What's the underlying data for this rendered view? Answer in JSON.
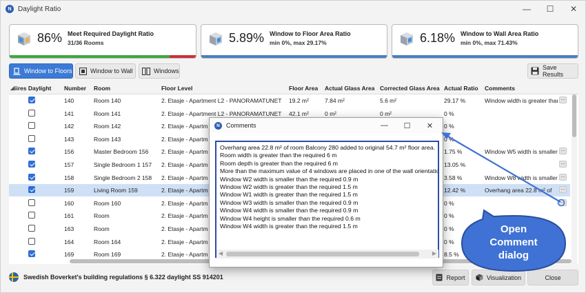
{
  "window": {
    "title": "Daylight Ratio",
    "app_icon": "N"
  },
  "colors": {
    "accent": "#3c7ad6",
    "green": "#3fa63f",
    "red": "#c8303c",
    "bar_blue": "#4a7fc1",
    "callout": "#3f72d4"
  },
  "cards": [
    {
      "pct": "86%",
      "title": "Meet Required Daylight Ratio",
      "sub": "31/36 Rooms",
      "green_fraction": 0.86
    },
    {
      "pct": "5.89%",
      "title": "Window to Floor Area Ratio",
      "sub": "min 0%, max 29.17%"
    },
    {
      "pct": "6.18%",
      "title": "Window to Wall Area Ratio",
      "sub": "min 0%, max 71.43%"
    }
  ],
  "toolbar": {
    "tab_floor": "Window to Floors",
    "tab_wall": "Window to Wall",
    "tab_windows": "Windows",
    "save": "Save Results"
  },
  "table": {
    "headers": [
      "iires Daylight",
      "Number",
      "Room",
      "Floor Level",
      "Floor Area",
      "Actual Glass Area",
      "Corrected Glass Area",
      "Actual Ratio",
      "Comments"
    ],
    "rows": [
      {
        "checked": true,
        "number": "140",
        "room": "Room 140",
        "floor": "2. Etasje - Apartment L2 - PANORAMATUNET",
        "area": "19.2 m²",
        "glass": "7.84 m²",
        "corrected": "5.6 m²",
        "ratio": "29.17 %",
        "comment": "Window  width is greater than",
        "dots": "..."
      },
      {
        "checked": false,
        "number": "141",
        "room": "Room 141",
        "floor": "2. Etasje - Apartment L2 - PANORAMATUNET",
        "area": "42.1 m²",
        "glass": "0 m²",
        "corrected": "0 m²",
        "ratio": "0 %",
        "comment": "",
        "dots": ""
      },
      {
        "checked": false,
        "number": "142",
        "room": "Room 142",
        "floor": "2. Etasje - Apartm",
        "area": "",
        "glass": "",
        "corrected": "",
        "ratio": "0 %",
        "comment": "",
        "dots": ""
      },
      {
        "checked": false,
        "number": "143",
        "room": "Room 143",
        "floor": "2. Etasje - Apartm",
        "area": "",
        "glass": "",
        "corrected": "",
        "ratio": "0 %",
        "comment": "",
        "dots": ""
      },
      {
        "checked": true,
        "number": "156",
        "room": "Master Bedroom 156",
        "floor": "2. Etasje - Apartm",
        "area": "",
        "glass": "",
        "corrected": "",
        "ratio": "1.75 %",
        "comment": "Window W5 width is smaller",
        "dots": "..."
      },
      {
        "checked": true,
        "number": "157",
        "room": "Single Bedroom 1 157",
        "floor": "2. Etasje - Apartm",
        "area": "",
        "glass": "",
        "corrected": "",
        "ratio": "13.05 %",
        "comment": "",
        "dots": "..."
      },
      {
        "checked": true,
        "number": "158",
        "room": "Single Bedroom 2 158",
        "floor": "2. Etasje - Apartm",
        "area": "",
        "glass": "",
        "corrected": "",
        "ratio": "3.58 %",
        "comment": "Window W8 width is smaller",
        "dots": "..."
      },
      {
        "checked": true,
        "number": "159",
        "room": "Living Room 159",
        "floor": "2. Etasje - Apartm",
        "area": "",
        "glass": "",
        "corrected": "",
        "ratio": "12.42 %",
        "comment": "Overhang area 22.8 m² of",
        "dots": "...",
        "selected": true
      },
      {
        "checked": false,
        "number": "160",
        "room": "Room 160",
        "floor": "2. Etasje - Apartm",
        "area": "",
        "glass": "",
        "corrected": "",
        "ratio": "0 %",
        "comment": "",
        "dots": "..."
      },
      {
        "checked": false,
        "number": "161",
        "room": "Room",
        "floor": "2. Etasje - Apartm",
        "area": "",
        "glass": "",
        "corrected": "",
        "ratio": "0 %",
        "comment": "",
        "dots": ""
      },
      {
        "checked": false,
        "number": "163",
        "room": "Room",
        "floor": "2. Etasje - Apartm",
        "area": "",
        "glass": "",
        "corrected": "",
        "ratio": "0 %",
        "comment": "",
        "dots": ""
      },
      {
        "checked": false,
        "number": "164",
        "room": "Room 164",
        "floor": "2. Etasje - Apartm",
        "area": "",
        "glass": "",
        "corrected": "",
        "ratio": "0 %",
        "comment": "",
        "dots": ""
      },
      {
        "checked": true,
        "number": "169",
        "room": "Room 169",
        "floor": "2. Etasje - Apartm",
        "area": "",
        "glass": "",
        "corrected": "",
        "ratio": "8.5 %",
        "comment": "",
        "dots": ""
      }
    ]
  },
  "footer": {
    "regulation": "Swedish Boverket's building regulations § 6.322 daylight SS 914201",
    "report": "Report",
    "visualization": "Visualization",
    "close": "Close"
  },
  "dialog": {
    "title": "Comments",
    "lines": [
      "Overhang area 22.8 m² of room Balcony 280 added to original 54.7 m² floor area.",
      "Room width is greater than the required 6 m",
      "Room depth is greater than the required 6 m",
      "More than the maximum value of 4 windows are placed in one of the wall orientatio",
      "Window W2 width is smaller than the required 0.9 m",
      "Window W2 width is greater than the required 1.5 m",
      "Window W1 width is greater than the required 1.5 m",
      "Window W3 width is smaller than the required 0.9 m",
      "Window W4 width is smaller than the required 0.9 m",
      "Window W4 height is smaller than the required 0.6 m",
      "Window W4 width is greater than the required 1.5 m"
    ]
  },
  "callout": {
    "line1": "Open",
    "line2": "Comment",
    "line3": "dialog"
  }
}
